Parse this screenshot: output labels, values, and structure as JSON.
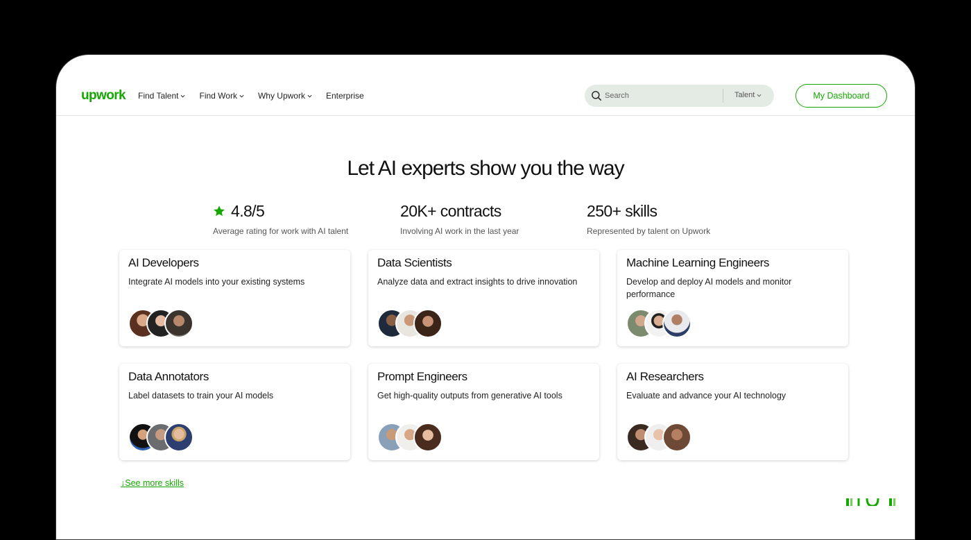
{
  "header": {
    "logo": "upwork",
    "nav": [
      {
        "label": "Find Talent"
      },
      {
        "label": "Find Work"
      },
      {
        "label": "Why Upwork"
      },
      {
        "label": "Enterprise"
      }
    ],
    "search": {
      "placeholder": "Search",
      "type_label": "Talent"
    },
    "dashboard_label": "My Dashboard"
  },
  "hero": {
    "title": "Let AI experts show you the way",
    "stats": [
      {
        "value": "4.8/5",
        "label": "Average rating for work with AI talent"
      },
      {
        "value": "20K+ contracts",
        "label": "Involving AI work in the last year"
      },
      {
        "value": "250+ skills",
        "label": "Represented by talent on Upwork"
      }
    ]
  },
  "cards": [
    {
      "title": "AI Developers",
      "desc": "Integrate AI models into your existing systems"
    },
    {
      "title": "Data Scientists",
      "desc": "Analyze data and extract insights to drive innovation"
    },
    {
      "title": "Machine Learning Engineers",
      "desc": "Develop and deploy AI models and monitor performance"
    },
    {
      "title": "Data Annotators",
      "desc": "Label datasets to train your AI models"
    },
    {
      "title": "Prompt Engineers",
      "desc": "Get high-quality outputs from generative AI tools"
    },
    {
      "title": "AI Researchers",
      "desc": "Evaluate and advance your AI technology"
    }
  ],
  "see_more": "See more skills",
  "colors": {
    "brand": "#14a800",
    "search_bg": "#e4ebe4",
    "text": "#111111"
  },
  "icons": [
    "search-icon",
    "star-icon",
    "chevron-down-icon",
    "arrow-down-icon"
  ]
}
